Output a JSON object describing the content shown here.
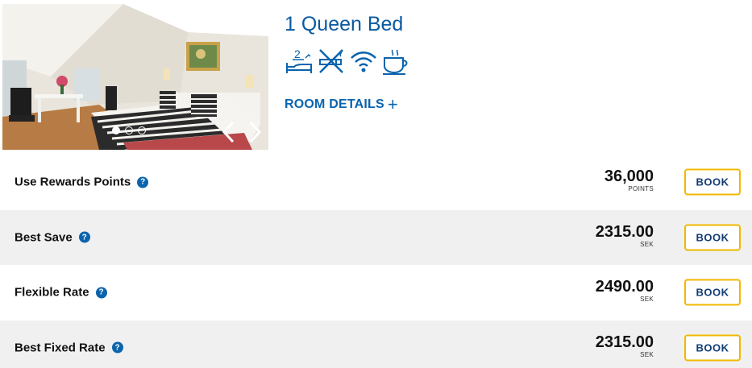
{
  "room": {
    "title": "1 Queen Bed",
    "details_label": "ROOM DETAILS",
    "amenities": [
      "bed-capacity-2-icon",
      "non-smoking-icon",
      "wifi-icon",
      "coffee-icon"
    ],
    "amenity_bed_count": "2",
    "photo_carousel": {
      "slides": 3,
      "active_slide": 1
    }
  },
  "rates": [
    {
      "name": "Use Rewards Points",
      "amount": "36,000",
      "unit": "POINTS",
      "book_label": "BOOK"
    },
    {
      "name": "Best Save",
      "amount": "2315.00",
      "unit": "SEK",
      "book_label": "BOOK"
    },
    {
      "name": "Flexible Rate",
      "amount": "2490.00",
      "unit": "SEK",
      "book_label": "BOOK"
    },
    {
      "name": "Best Fixed Rate",
      "amount": "2315.00",
      "unit": "SEK",
      "book_label": "BOOK"
    }
  ],
  "colors": {
    "brand_blue": "#0a5aa0",
    "book_border": "#f2b800",
    "book_text": "#123c74",
    "row_shade": "#f0f0f0"
  }
}
